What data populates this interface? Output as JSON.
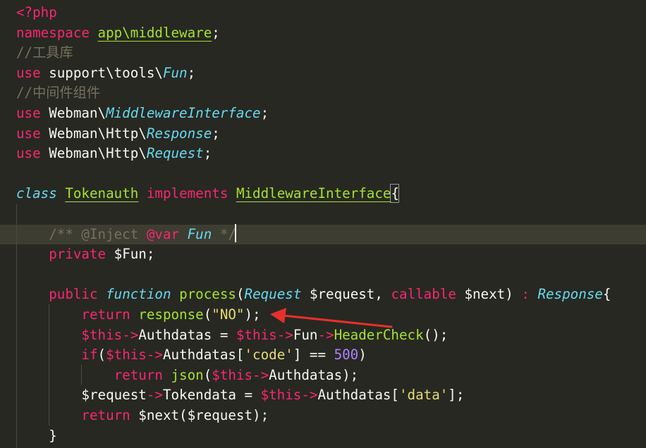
{
  "code_lines": [
    {
      "tokens": [
        {
          "t": "<?php",
          "c": "kw"
        }
      ]
    },
    {
      "tokens": [
        {
          "t": "namespace",
          "c": "kw"
        },
        {
          "t": " "
        },
        {
          "t": "app\\middleware",
          "c": "fn",
          "u": true
        },
        {
          "t": ";"
        }
      ]
    },
    {
      "tokens": [
        {
          "t": "//工具库",
          "c": "cmt"
        }
      ]
    },
    {
      "tokens": [
        {
          "t": "use",
          "c": "kw"
        },
        {
          "t": " support\\tools\\"
        },
        {
          "t": "Fun",
          "c": "typ"
        },
        {
          "t": ";"
        }
      ]
    },
    {
      "tokens": [
        {
          "t": "//中间件组件",
          "c": "cmt"
        }
      ]
    },
    {
      "tokens": [
        {
          "t": "use",
          "c": "kw"
        },
        {
          "t": " Webman\\"
        },
        {
          "t": "MiddlewareInterface",
          "c": "typ"
        },
        {
          "t": ";"
        }
      ]
    },
    {
      "tokens": [
        {
          "t": "use",
          "c": "kw"
        },
        {
          "t": " Webman\\Http\\"
        },
        {
          "t": "Response",
          "c": "typ"
        },
        {
          "t": ";"
        }
      ]
    },
    {
      "tokens": [
        {
          "t": "use",
          "c": "kw"
        },
        {
          "t": " Webman\\Http\\"
        },
        {
          "t": "Request",
          "c": "typ"
        },
        {
          "t": ";"
        }
      ]
    },
    {
      "tokens": []
    },
    {
      "tokens": [
        {
          "t": "class",
          "c": "typ"
        },
        {
          "t": " "
        },
        {
          "t": "Tokenauth",
          "c": "fn",
          "u": true
        },
        {
          "t": " "
        },
        {
          "t": "implements",
          "c": "kw"
        },
        {
          "t": " "
        },
        {
          "t": "MiddlewareInterface",
          "c": "fn",
          "u": true
        },
        {
          "t": "{"
        }
      ]
    },
    {
      "tokens": []
    },
    {
      "tokens": [
        {
          "t": "    "
        },
        {
          "t": "/** @Inject ",
          "c": "cmt"
        },
        {
          "t": "@var",
          "c": "kw"
        },
        {
          "t": " "
        },
        {
          "t": "Fun",
          "c": "typ"
        },
        {
          "t": " */",
          "c": "cmt"
        }
      ]
    },
    {
      "tokens": [
        {
          "t": "    "
        },
        {
          "t": "private",
          "c": "kw"
        },
        {
          "t": " $Fun;"
        }
      ]
    },
    {
      "tokens": []
    },
    {
      "tokens": [
        {
          "t": "    "
        },
        {
          "t": "public",
          "c": "kw"
        },
        {
          "t": " "
        },
        {
          "t": "function",
          "c": "typ"
        },
        {
          "t": " "
        },
        {
          "t": "process",
          "c": "fn"
        },
        {
          "t": "("
        },
        {
          "t": "Request",
          "c": "typ"
        },
        {
          "t": " $request, "
        },
        {
          "t": "callable",
          "c": "kw"
        },
        {
          "t": " $next) "
        },
        {
          "t": ":",
          "c": "kw"
        },
        {
          "t": " "
        },
        {
          "t": "Response",
          "c": "typ"
        },
        {
          "t": "{"
        }
      ]
    },
    {
      "tokens": [
        {
          "t": "        "
        },
        {
          "t": "return",
          "c": "kw"
        },
        {
          "t": " "
        },
        {
          "t": "response",
          "c": "fn"
        },
        {
          "t": "("
        },
        {
          "t": "\"NO\"",
          "c": "str"
        },
        {
          "t": ");"
        }
      ]
    },
    {
      "tokens": [
        {
          "t": "        "
        },
        {
          "t": "$this",
          "c": "kw"
        },
        {
          "t": "->",
          "c": "kw"
        },
        {
          "t": "Authdatas = "
        },
        {
          "t": "$this",
          "c": "kw"
        },
        {
          "t": "->",
          "c": "kw"
        },
        {
          "t": "Fun"
        },
        {
          "t": "->",
          "c": "kw"
        },
        {
          "t": "HeaderCheck",
          "c": "fn"
        },
        {
          "t": "();"
        }
      ]
    },
    {
      "tokens": [
        {
          "t": "        "
        },
        {
          "t": "if",
          "c": "kw"
        },
        {
          "t": "("
        },
        {
          "t": "$this",
          "c": "kw"
        },
        {
          "t": "->",
          "c": "kw"
        },
        {
          "t": "Authdatas["
        },
        {
          "t": "'code'",
          "c": "str"
        },
        {
          "t": "] == "
        },
        {
          "t": "500",
          "c": "num"
        },
        {
          "t": ")"
        }
      ]
    },
    {
      "tokens": [
        {
          "t": "            "
        },
        {
          "t": "return",
          "c": "kw"
        },
        {
          "t": " "
        },
        {
          "t": "json",
          "c": "fn"
        },
        {
          "t": "("
        },
        {
          "t": "$this",
          "c": "kw"
        },
        {
          "t": "->",
          "c": "kw"
        },
        {
          "t": "Authdatas);"
        }
      ]
    },
    {
      "tokens": [
        {
          "t": "        $request"
        },
        {
          "t": "->",
          "c": "kw"
        },
        {
          "t": "Tokendata = "
        },
        {
          "t": "$this",
          "c": "kw"
        },
        {
          "t": "->",
          "c": "kw"
        },
        {
          "t": "Authdatas["
        },
        {
          "t": "'data'",
          "c": "str"
        },
        {
          "t": "];"
        }
      ]
    },
    {
      "tokens": [
        {
          "t": "        "
        },
        {
          "t": "return",
          "c": "kw"
        },
        {
          "t": " $next($request);"
        }
      ]
    },
    {
      "tokens": [
        {
          "t": "    }"
        }
      ]
    }
  ],
  "colors": {
    "background": "#272822",
    "keyword": "#f92672",
    "type": "#66d9ef",
    "function": "#a6e22e",
    "comment": "#75715e",
    "string": "#e6db74",
    "number": "#ae81ff",
    "arrow": "#e8302a"
  }
}
